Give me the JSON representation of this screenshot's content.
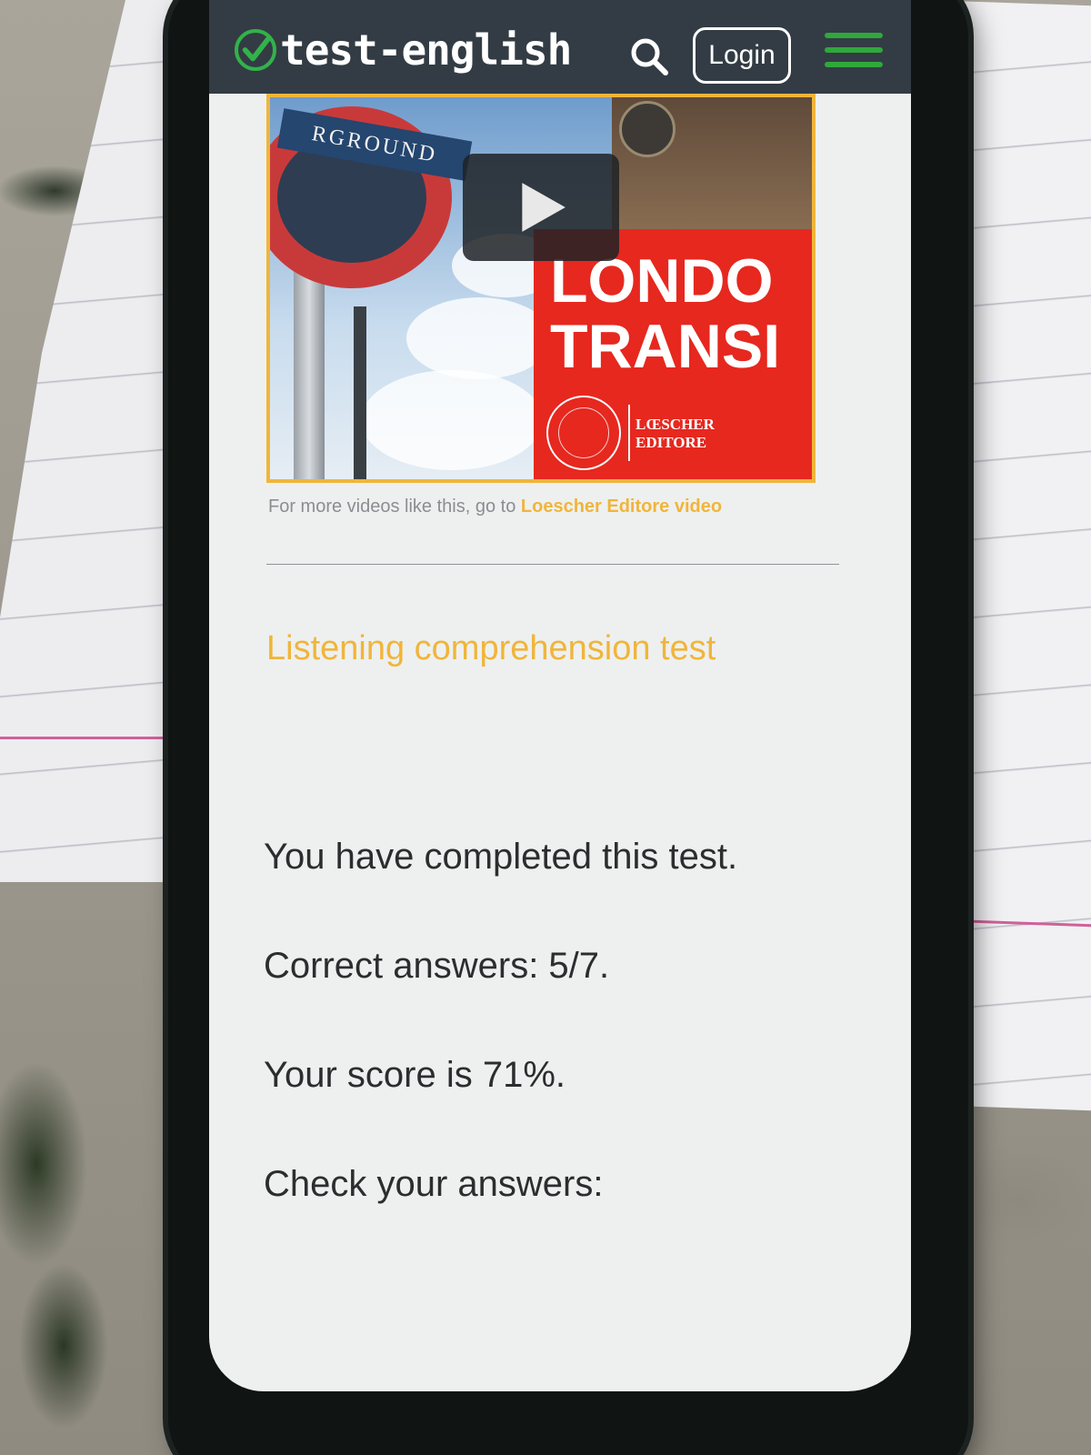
{
  "header": {
    "logo_text": "test-english",
    "login_label": "Login"
  },
  "video": {
    "title_line1": "LONDO",
    "title_line2": "TRANSI",
    "sign_text": "RGROUND",
    "publisher_line1": "LŒSCHER",
    "publisher_line2": "EDITORE"
  },
  "more_videos": {
    "prefix": "For more videos like this, go to ",
    "link": "Loescher Editore video"
  },
  "section": {
    "title": "Listening comprehension test"
  },
  "results": {
    "completed": "You have completed this test.",
    "correct": "Correct answers: 5/7.",
    "score": "Your score is 71%.",
    "check": "Check your answers:"
  },
  "colors": {
    "header_bg": "#333c44",
    "accent": "#f0b53a",
    "brand_green": "#33b24a"
  }
}
